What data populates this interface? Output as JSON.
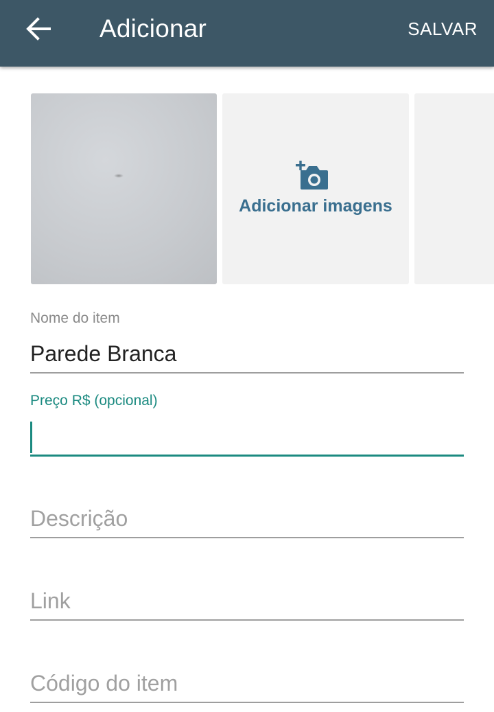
{
  "appbar": {
    "title": "Adicionar",
    "save_label": "SALVAR",
    "back_icon": "arrow-left-icon"
  },
  "gallery": {
    "add_label": "Adicionar imagens",
    "add_icon": "add-photo-icon",
    "accent_color": "#3a6f8f"
  },
  "form": {
    "name": {
      "label": "Nome do item",
      "value": "Parede Branca"
    },
    "price": {
      "label": "Preço R$ (opcional)",
      "value": ""
    },
    "description": {
      "placeholder": "Descrição"
    },
    "link": {
      "placeholder": "Link"
    },
    "code": {
      "placeholder": "Código do item"
    }
  },
  "colors": {
    "appbar": "#3d5766",
    "focus": "#1b8a80"
  }
}
